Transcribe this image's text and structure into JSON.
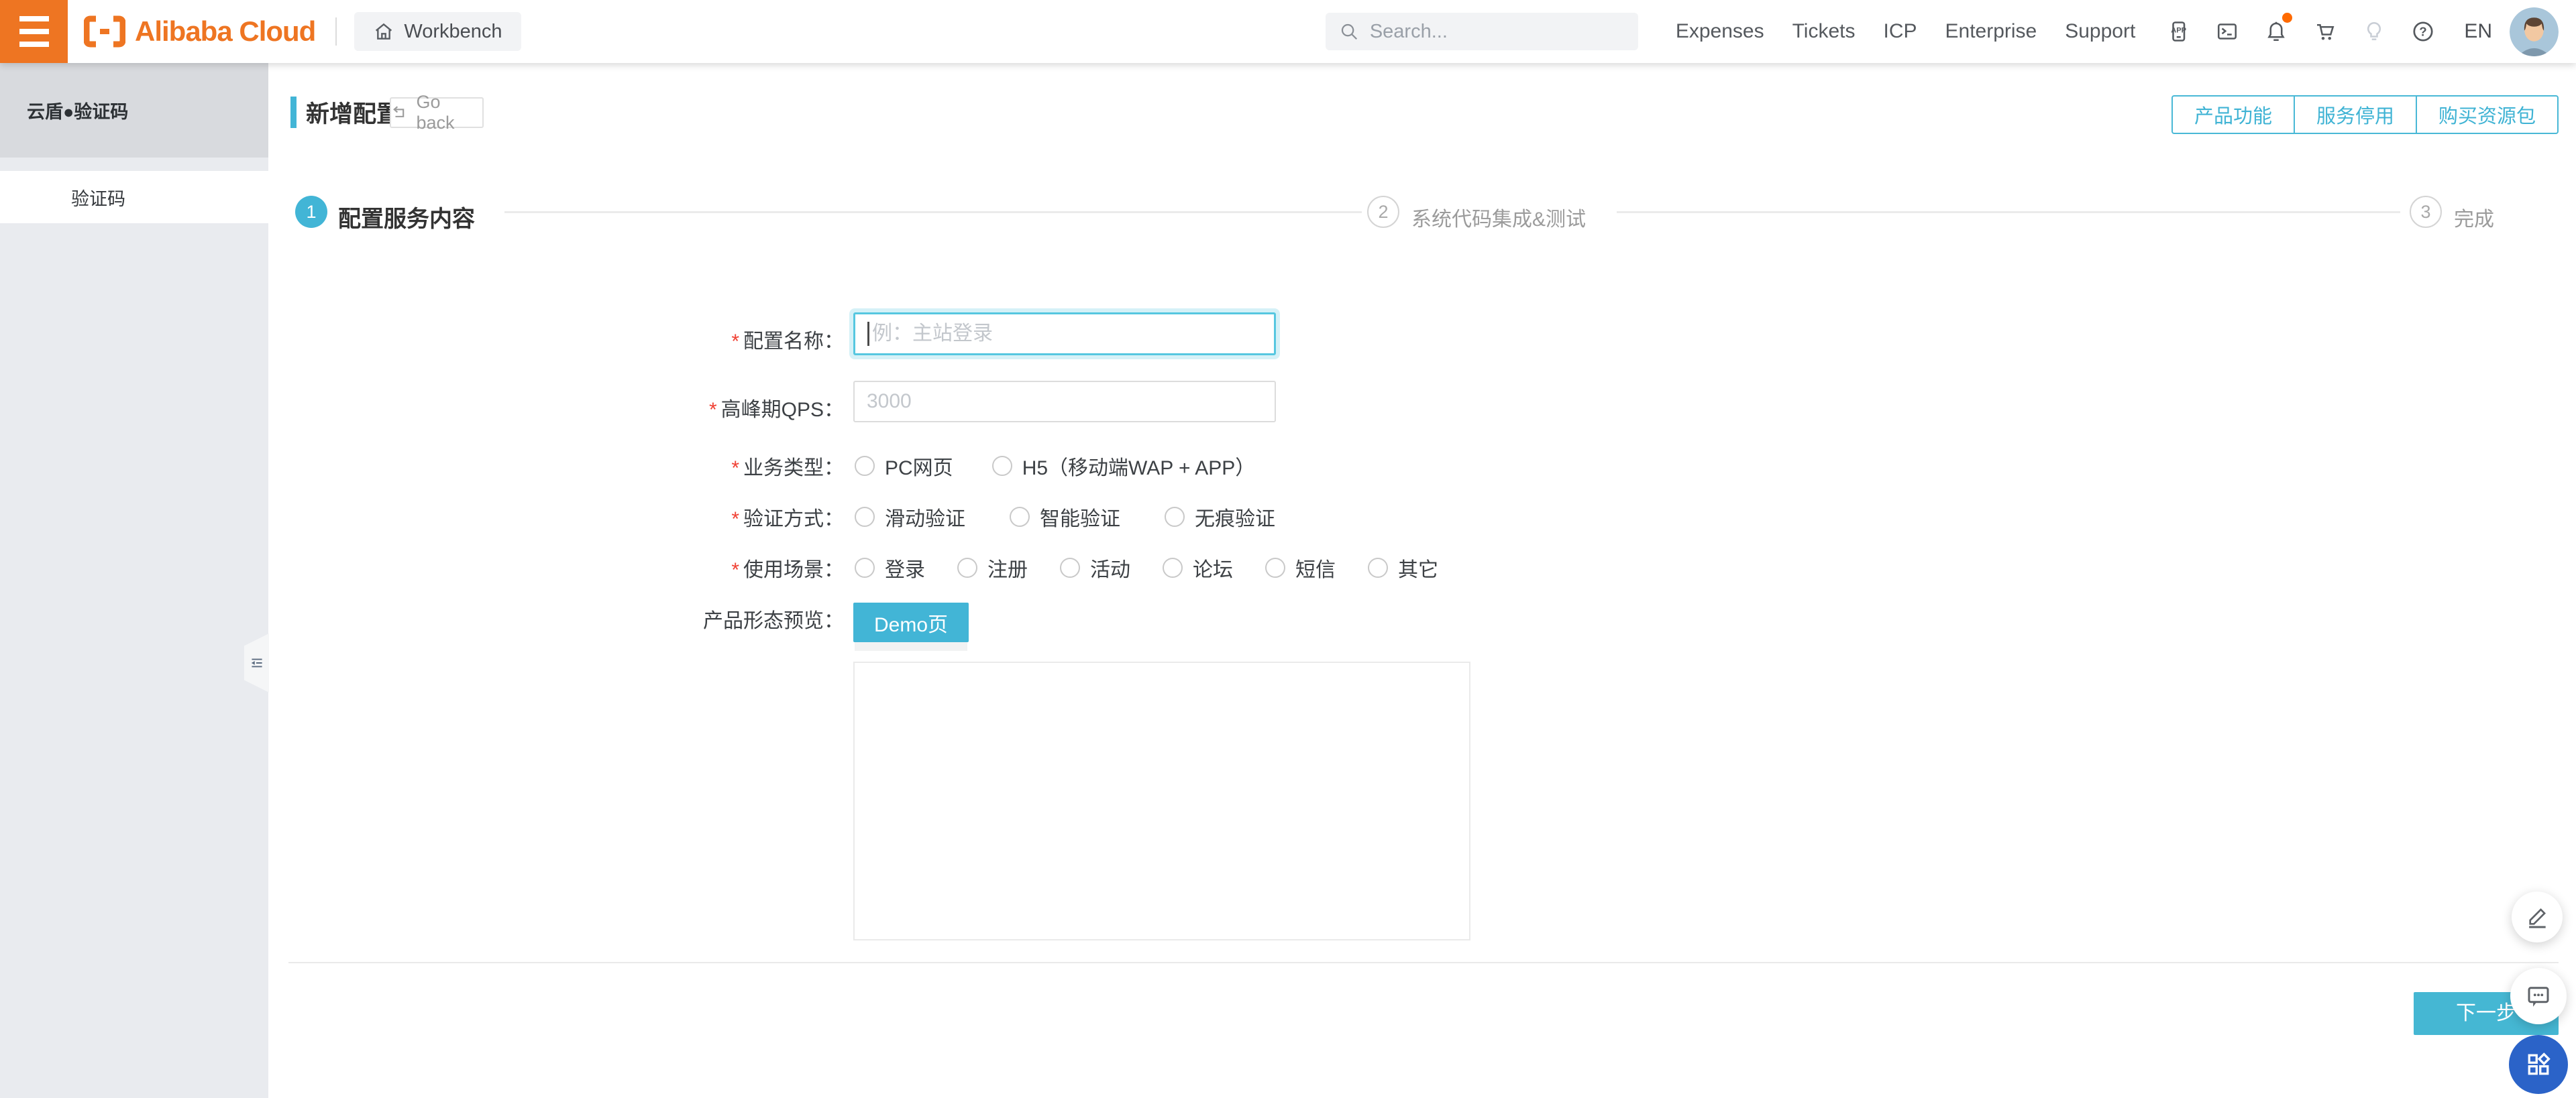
{
  "nav": {
    "workbench_label": "Workbench",
    "search_placeholder": "Search...",
    "links": [
      {
        "label": "Expenses"
      },
      {
        "label": "Tickets"
      },
      {
        "label": "ICP"
      },
      {
        "label": "Enterprise"
      },
      {
        "label": "Support"
      }
    ],
    "language": "EN"
  },
  "sidebar": {
    "product_title": "云盾●验证码",
    "items": [
      {
        "label": "验证码",
        "selected": true
      }
    ]
  },
  "page": {
    "title": "新增配置",
    "go_back_label": "Go back",
    "header_actions": [
      {
        "label": "产品功能"
      },
      {
        "label": "服务停用"
      },
      {
        "label": "购买资源包"
      }
    ],
    "steps": [
      {
        "num": "1",
        "label": "配置服务内容",
        "state": "active"
      },
      {
        "num": "2",
        "label": "系统代码集成&测试",
        "state": "pending"
      },
      {
        "num": "3",
        "label": "完成",
        "state": "pending"
      }
    ]
  },
  "form": {
    "required_mark": "*",
    "config_name": {
      "label": "配置名称：",
      "placeholder": "例：主站登录",
      "value": ""
    },
    "peak_qps": {
      "label": "高峰期QPS：",
      "placeholder": "3000",
      "value": ""
    },
    "business_type": {
      "label": "业务类型：",
      "options": [
        {
          "label": "PC网页",
          "checked": false
        },
        {
          "label": "H5（移动端WAP + APP）",
          "checked": false
        }
      ]
    },
    "verify_method": {
      "label": "验证方式：",
      "options": [
        {
          "label": "滑动验证",
          "checked": false
        },
        {
          "label": "智能验证",
          "checked": false
        },
        {
          "label": "无痕验证",
          "checked": false
        }
      ]
    },
    "usage_scene": {
      "label": "使用场景：",
      "options": [
        {
          "label": "登录",
          "checked": false
        },
        {
          "label": "注册",
          "checked": false
        },
        {
          "label": "活动",
          "checked": false
        },
        {
          "label": "论坛",
          "checked": false
        },
        {
          "label": "短信",
          "checked": false
        },
        {
          "label": "其它",
          "checked": false
        }
      ]
    },
    "product_preview": {
      "label": "产品形态预览：",
      "demo_button_label": "Demo页"
    },
    "next_button_label": "下一步"
  },
  "colors": {
    "accent_teal": "#42b5d6",
    "brand_orange": "#ee7522",
    "fab_blue": "#2b63c8",
    "required_red": "#f04134",
    "badge_orange": "#ff6a00"
  }
}
